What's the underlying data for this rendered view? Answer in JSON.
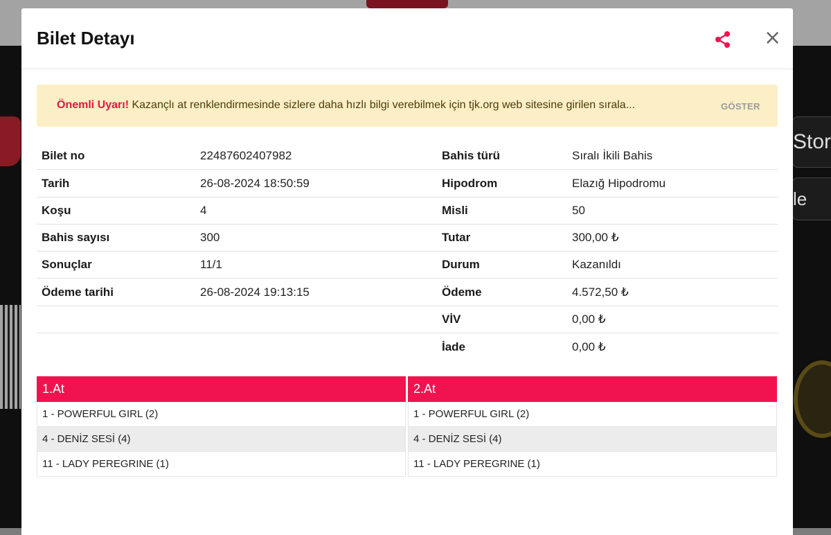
{
  "modal": {
    "title": "Bilet Detayı",
    "share_icon": "share-icon",
    "close_symbol": "×",
    "accent_color": "#f0134f"
  },
  "alert": {
    "strong": "Önemli Uyarı!",
    "text": " Kazançlı at renklendirmesinde sizlere daha hızlı bilgi verebilmek için tjk.org web sitesine girilen sırala...",
    "action": "GÖSTER"
  },
  "details": {
    "left": [
      {
        "label": "Bilet no",
        "value": "22487602407982"
      },
      {
        "label": "Tarih",
        "value": "26-08-2024 18:50:59"
      },
      {
        "label": "Koşu",
        "value": "4"
      },
      {
        "label": "Bahis sayısı",
        "value": "300"
      },
      {
        "label": "Sonuçlar",
        "value": "11/1"
      },
      {
        "label": "Ödeme tarihi",
        "value": "26-08-2024 19:13:15"
      }
    ],
    "right": [
      {
        "label": "Bahis türü",
        "value": "Sıralı İkili Bahis"
      },
      {
        "label": "Hipodrom",
        "value": "Elazığ Hipodromu"
      },
      {
        "label": "Misli",
        "value": "50"
      },
      {
        "label": "Tutar",
        "value": "300,00 ₺"
      },
      {
        "label": "Durum",
        "value": "Kazanıldı"
      },
      {
        "label": "Ödeme",
        "value": "4.572,50 ₺"
      },
      {
        "label": "VİV",
        "value": "0,00 ₺"
      },
      {
        "label": "İade",
        "value": "0,00 ₺"
      }
    ]
  },
  "horses": {
    "first": {
      "header": "1.At",
      "items": [
        "1 - POWERFUL GIRL (2)",
        "4 - DENİZ SESİ (4)",
        "11 - LADY PEREGRINE (1)"
      ]
    },
    "second": {
      "header": "2.At",
      "items": [
        "1 - POWERFUL GIRL (2)",
        "4 - DENİZ SESİ (4)",
        "11 - LADY PEREGRINE (1)"
      ]
    }
  },
  "background": {
    "store_text": "Stor",
    "play_text": "le Pla"
  }
}
